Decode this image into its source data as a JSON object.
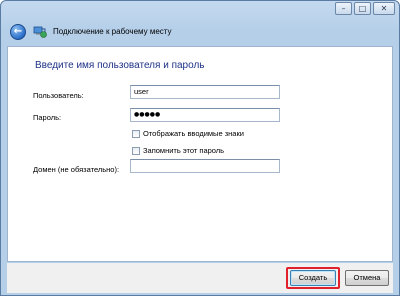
{
  "window": {
    "title": "Подключение к рабочему месту",
    "controls": {
      "minimize": "–",
      "maximize": "□",
      "close": "✕"
    },
    "back_icon": "back-arrow-icon",
    "app_icon": "network-connection-icon"
  },
  "form": {
    "heading": "Введите имя пользователя и пароль",
    "username_label": "Пользователь:",
    "username_value": "user",
    "password_label": "Пароль:",
    "password_value": "●●●●●",
    "show_chars_label": "Отображать вводимые знаки",
    "show_chars_checked": false,
    "remember_label": "Запомнить этот пароль",
    "remember_checked": false,
    "domain_label": "Домен (не обязательно):",
    "domain_value": ""
  },
  "footer": {
    "create_label": "Создать",
    "cancel_label": "Отмена"
  },
  "colors": {
    "heading": "#1e3287",
    "highlight": "#e0202a",
    "accent": "#3c7fb1"
  }
}
